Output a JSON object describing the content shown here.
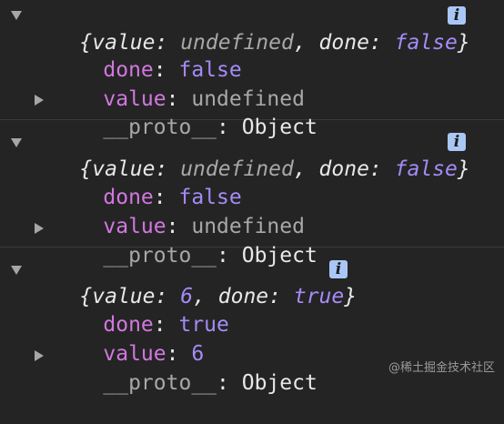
{
  "entries": [
    {
      "summary_open": "{",
      "summary_k1": "value",
      "summary_v1": "undefined",
      "summary_k2": "done",
      "summary_v2": "false",
      "summary_close": "}",
      "done_key": "done",
      "done_value": "false",
      "value_key": "value",
      "value_value": "undefined",
      "proto_key": "__proto__",
      "proto_value": "Object"
    },
    {
      "summary_open": "{",
      "summary_k1": "value",
      "summary_v1": "undefined",
      "summary_k2": "done",
      "summary_v2": "false",
      "summary_close": "}",
      "done_key": "done",
      "done_value": "false",
      "value_key": "value",
      "value_value": "undefined",
      "proto_key": "__proto__",
      "proto_value": "Object"
    },
    {
      "summary_open": "{",
      "summary_k1": "value",
      "summary_v1": "6",
      "summary_k2": "done",
      "summary_v2": "true",
      "summary_close": "}",
      "done_key": "done",
      "done_value": "true",
      "value_key": "value",
      "value_value": "6",
      "proto_key": "__proto__",
      "proto_value": "Object"
    }
  ],
  "info_icon_glyph": "i",
  "watermark": "@稀土掘金技术社区",
  "colors": {
    "background": "#242424",
    "key": "#d277e0",
    "boolean": "#a58bf6",
    "info_badge": "#a9c7f5"
  }
}
